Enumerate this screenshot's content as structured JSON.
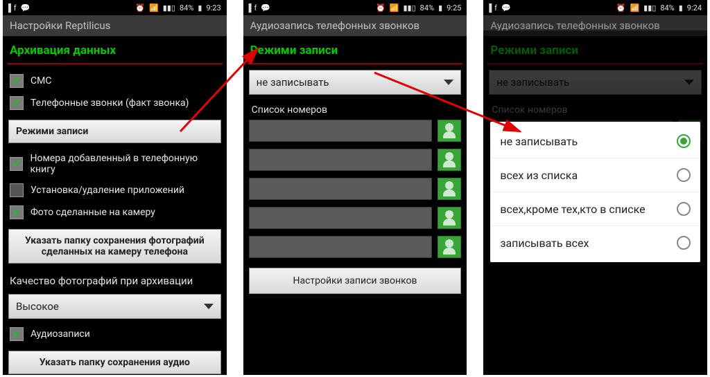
{
  "status": {
    "battery": "84%",
    "time1": "9:23",
    "time2": "9:25",
    "time3": "9:24"
  },
  "screen1": {
    "title": "Настройки Reptilicus",
    "section": "Архивация данных",
    "items": {
      "sms": "СМС",
      "calls": "Телефонные звонки (факт звонка)",
      "modes_btn": "Режими записи",
      "contacts": "Номера добавленный в телефонную книгу",
      "apps": "Установка/удаление приложений",
      "photos": "Фото сделанные на камеру",
      "photo_folder_btn": "Указать папку сохранения фотографий сделанных на камеру телефона",
      "quality_label": "Качество фотографий при архивации",
      "quality_value": "Высокое",
      "audio": "Аудиозаписи",
      "audio_folder_btn": "Указать папку сохранения аудио"
    }
  },
  "screen2": {
    "title": "Аудиозапись телефонных звонков",
    "section": "Режими записи",
    "mode_value": "не записывать",
    "list_label": "Список номеров",
    "settings_btn": "Настройки записи звонков"
  },
  "screen3": {
    "title": "Аудиозапись телефонных звонков",
    "section": "Режими записи",
    "mode_value": "не записывать",
    "list_label": "Список номеров",
    "options": [
      "не записывать",
      "всех из списка",
      "всех,кроме тех,кто в списке",
      "записывать всех"
    ],
    "selected_index": 0
  }
}
